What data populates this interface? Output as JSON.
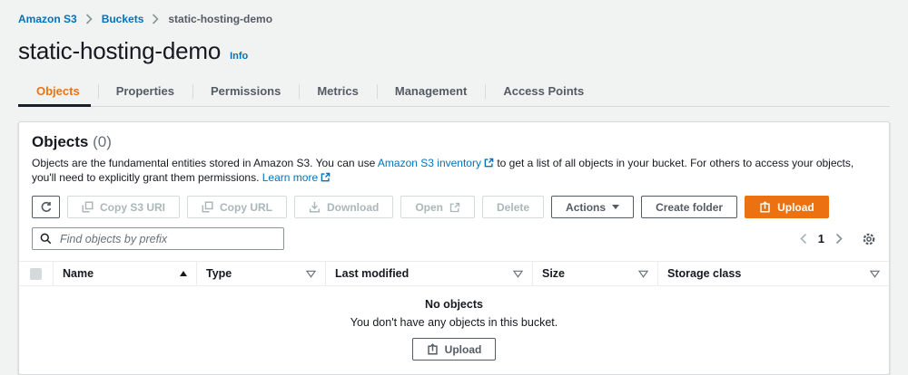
{
  "colors": {
    "accent_orange": "#ec7211",
    "link_blue": "#0073bb",
    "text_dark": "#16191f",
    "text_gray": "#545b64",
    "disabled": "#aab7b8",
    "page_background": "#f1f3f3",
    "panel_border": "#d5dbdb"
  },
  "breadcrumb": {
    "item1": "Amazon S3",
    "item2": "Buckets",
    "item3": "static-hosting-demo"
  },
  "header": {
    "title": "static-hosting-demo",
    "info": "Info"
  },
  "tabs": [
    {
      "label": "Objects"
    },
    {
      "label": "Properties"
    },
    {
      "label": "Permissions"
    },
    {
      "label": "Metrics"
    },
    {
      "label": "Management"
    },
    {
      "label": "Access Points"
    }
  ],
  "panel": {
    "heading": "Objects",
    "count": "(0)",
    "description": {
      "part1": "Objects are the fundamental entities stored in Amazon S3. You can use",
      "inventory_link": "Amazon S3 inventory",
      "part2": "to get a list of all objects in your bucket. For others to access your objects, you'll need to explicitly grant them permissions.",
      "learn_more": "Learn more"
    },
    "toolbar": {
      "copy_s3_uri": "Copy S3 URI",
      "copy_url": "Copy URL",
      "download": "Download",
      "open": "Open",
      "delete": "Delete",
      "actions": "Actions",
      "create_folder": "Create folder",
      "upload": "Upload"
    },
    "search": {
      "placeholder": "Find objects by prefix"
    },
    "pagination": {
      "current_page": "1"
    },
    "table": {
      "columns": [
        {
          "label": "Name"
        },
        {
          "label": "Type"
        },
        {
          "label": "Last modified"
        },
        {
          "label": "Size"
        },
        {
          "label": "Storage class"
        }
      ]
    },
    "empty": {
      "title": "No objects",
      "message": "You don't have any objects in this bucket.",
      "upload": "Upload"
    }
  }
}
